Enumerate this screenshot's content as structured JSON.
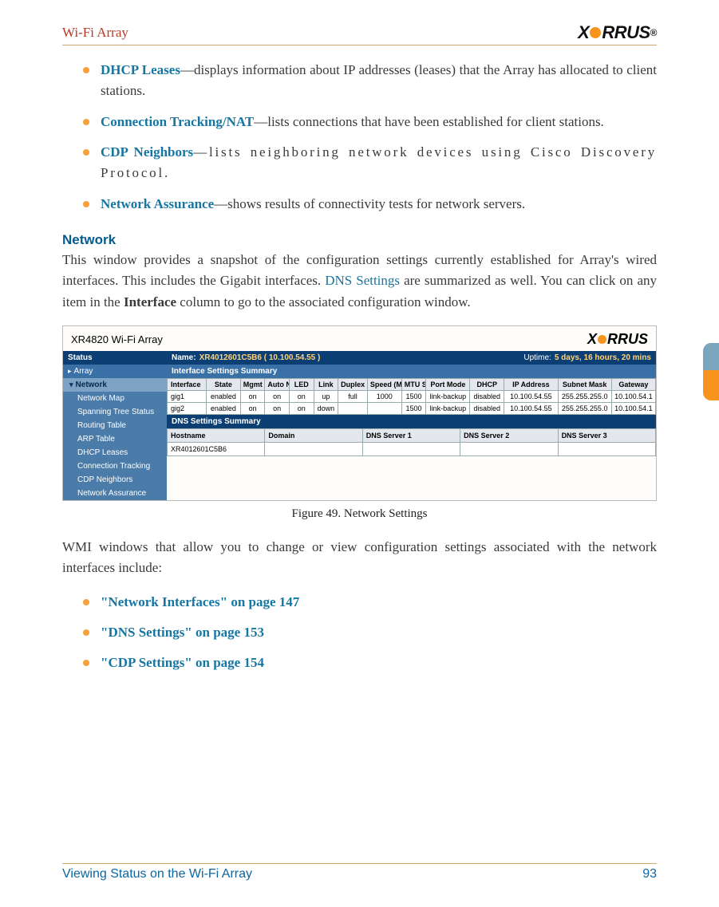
{
  "header": {
    "title": "Wi-Fi Array",
    "logo_text_a": "X",
    "logo_text_b": "RRUS",
    "logo_reg": "®"
  },
  "bullets_top": [
    {
      "term": "DHCP Leases",
      "rest": "—displays information about IP addresses (leases) that the Array has allocated to client stations."
    },
    {
      "term": "Connection Tracking/NAT",
      "rest": "—lists connections that have been established for client stations."
    },
    {
      "term": "CDP Neighbors",
      "rest": "—lists neighboring network devices using Cisco Discovery Protocol."
    },
    {
      "term": "Network Assurance",
      "rest": "—shows results of connectivity tests for network servers."
    }
  ],
  "section": {
    "heading": "Network",
    "para_a": "This window provides a snapshot of the configuration settings currently established for Array's wired interfaces. This includes the Gigabit interfaces. ",
    "link_dns": "DNS Settings",
    "para_b": " are summarized as well. You can click on any item in the ",
    "bold_iface": "Interface",
    "para_c": " column to go to the associated configuration window."
  },
  "figure": {
    "caption": "Figure 49. Network Settings"
  },
  "screenshot": {
    "title": "XR4820 Wi-Fi Array",
    "logo_a": "X",
    "logo_b": "RRUS",
    "status_label": "Status",
    "array_label": "Array",
    "network_label": "Network",
    "sidebar_items": [
      "Network Map",
      "Spanning Tree Status",
      "Routing Table",
      "ARP Table",
      "DHCP Leases",
      "Connection Tracking",
      "CDP Neighbors",
      "Network Assurance"
    ],
    "name_label": "Name:",
    "name_value": "XR4012601C5B6   ( 10.100.54.55 )",
    "uptime_label": "Uptime:",
    "uptime_value": "5 days, 16 hours, 20 mins",
    "iface_summary_label": "Interface Settings Summary",
    "iface_cols": [
      "Interface",
      "State",
      "Mgmt",
      "Auto Neg",
      "LED",
      "Link",
      "Duplex",
      "Speed (Mbps)",
      "MTU Size",
      "Port Mode",
      "DHCP",
      "IP Address",
      "Subnet Mask",
      "Gateway"
    ],
    "iface_rows": [
      [
        "gig1",
        "enabled",
        "on",
        "on",
        "on",
        "up",
        "full",
        "1000",
        "1500",
        "link-backup",
        "disabled",
        "10.100.54.55",
        "255.255.255.0",
        "10.100.54.1"
      ],
      [
        "gig2",
        "enabled",
        "on",
        "on",
        "on",
        "down",
        "",
        "",
        "1500",
        "link-backup",
        "disabled",
        "10.100.54.55",
        "255.255.255.0",
        "10.100.54.1"
      ]
    ],
    "dns_summary_label": "DNS Settings Summary",
    "dns_cols": [
      "Hostname",
      "Domain",
      "DNS Server 1",
      "DNS Server 2",
      "DNS Server 3"
    ],
    "dns_row": [
      "XR4012601C5B6",
      "",
      "",
      "",
      ""
    ]
  },
  "para_after_fig": "WMI windows that allow you to change or view configuration settings associated with the network interfaces include:",
  "bullets_bottom": [
    "\"Network Interfaces\" on page 147",
    "\"DNS Settings\" on page 153",
    "\"CDP Settings\" on page 154"
  ],
  "footer": {
    "left": "Viewing Status on the Wi-Fi Array",
    "right": "93"
  }
}
